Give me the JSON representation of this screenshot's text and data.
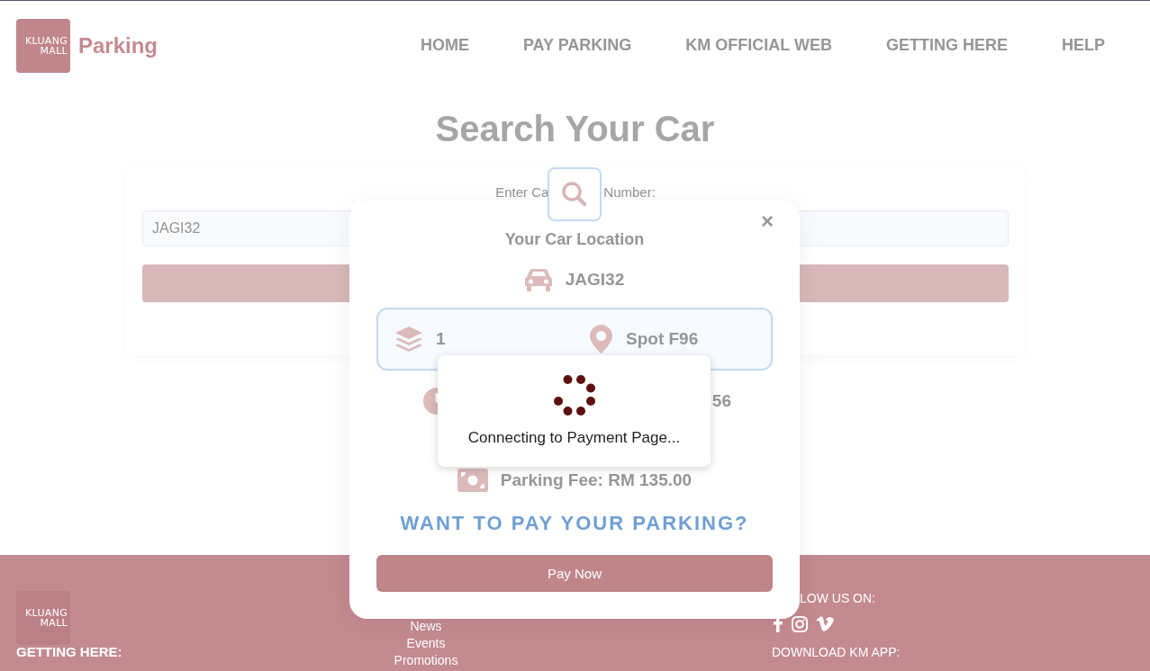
{
  "header": {
    "logo": "KLUANG MALL",
    "brand": "Parking",
    "nav": [
      "HOME",
      "PAY PARKING",
      "KM OFFICIAL WEB",
      "GETTING HERE",
      "HELP"
    ]
  },
  "page_title": "Search Your Car",
  "search_form": {
    "label_fragments": [
      "Enter Ca",
      "Number:"
    ],
    "plate_input": {
      "value": "JAGI32"
    }
  },
  "location_modal": {
    "close": "×",
    "title": "Your Car Location",
    "plate": "JAGI32",
    "floor": "1",
    "spot": "Spot F96",
    "clock_row_text": "56",
    "fee": "Parking Fee: RM 135.00",
    "prompt": "WANT TO PAY YOUR PARKING?",
    "pay_button": "Pay Now"
  },
  "loading_dialog": {
    "message": "Connecting to Payment Page..."
  },
  "footer": {
    "logo": "KLUANG MALL",
    "getting_here": "GETTING HERE:",
    "links": [
      "News",
      "Events",
      "Promotions"
    ],
    "follow_label": "LOW US ON:",
    "download_label": "DOWNLOAD KM APP:"
  }
}
